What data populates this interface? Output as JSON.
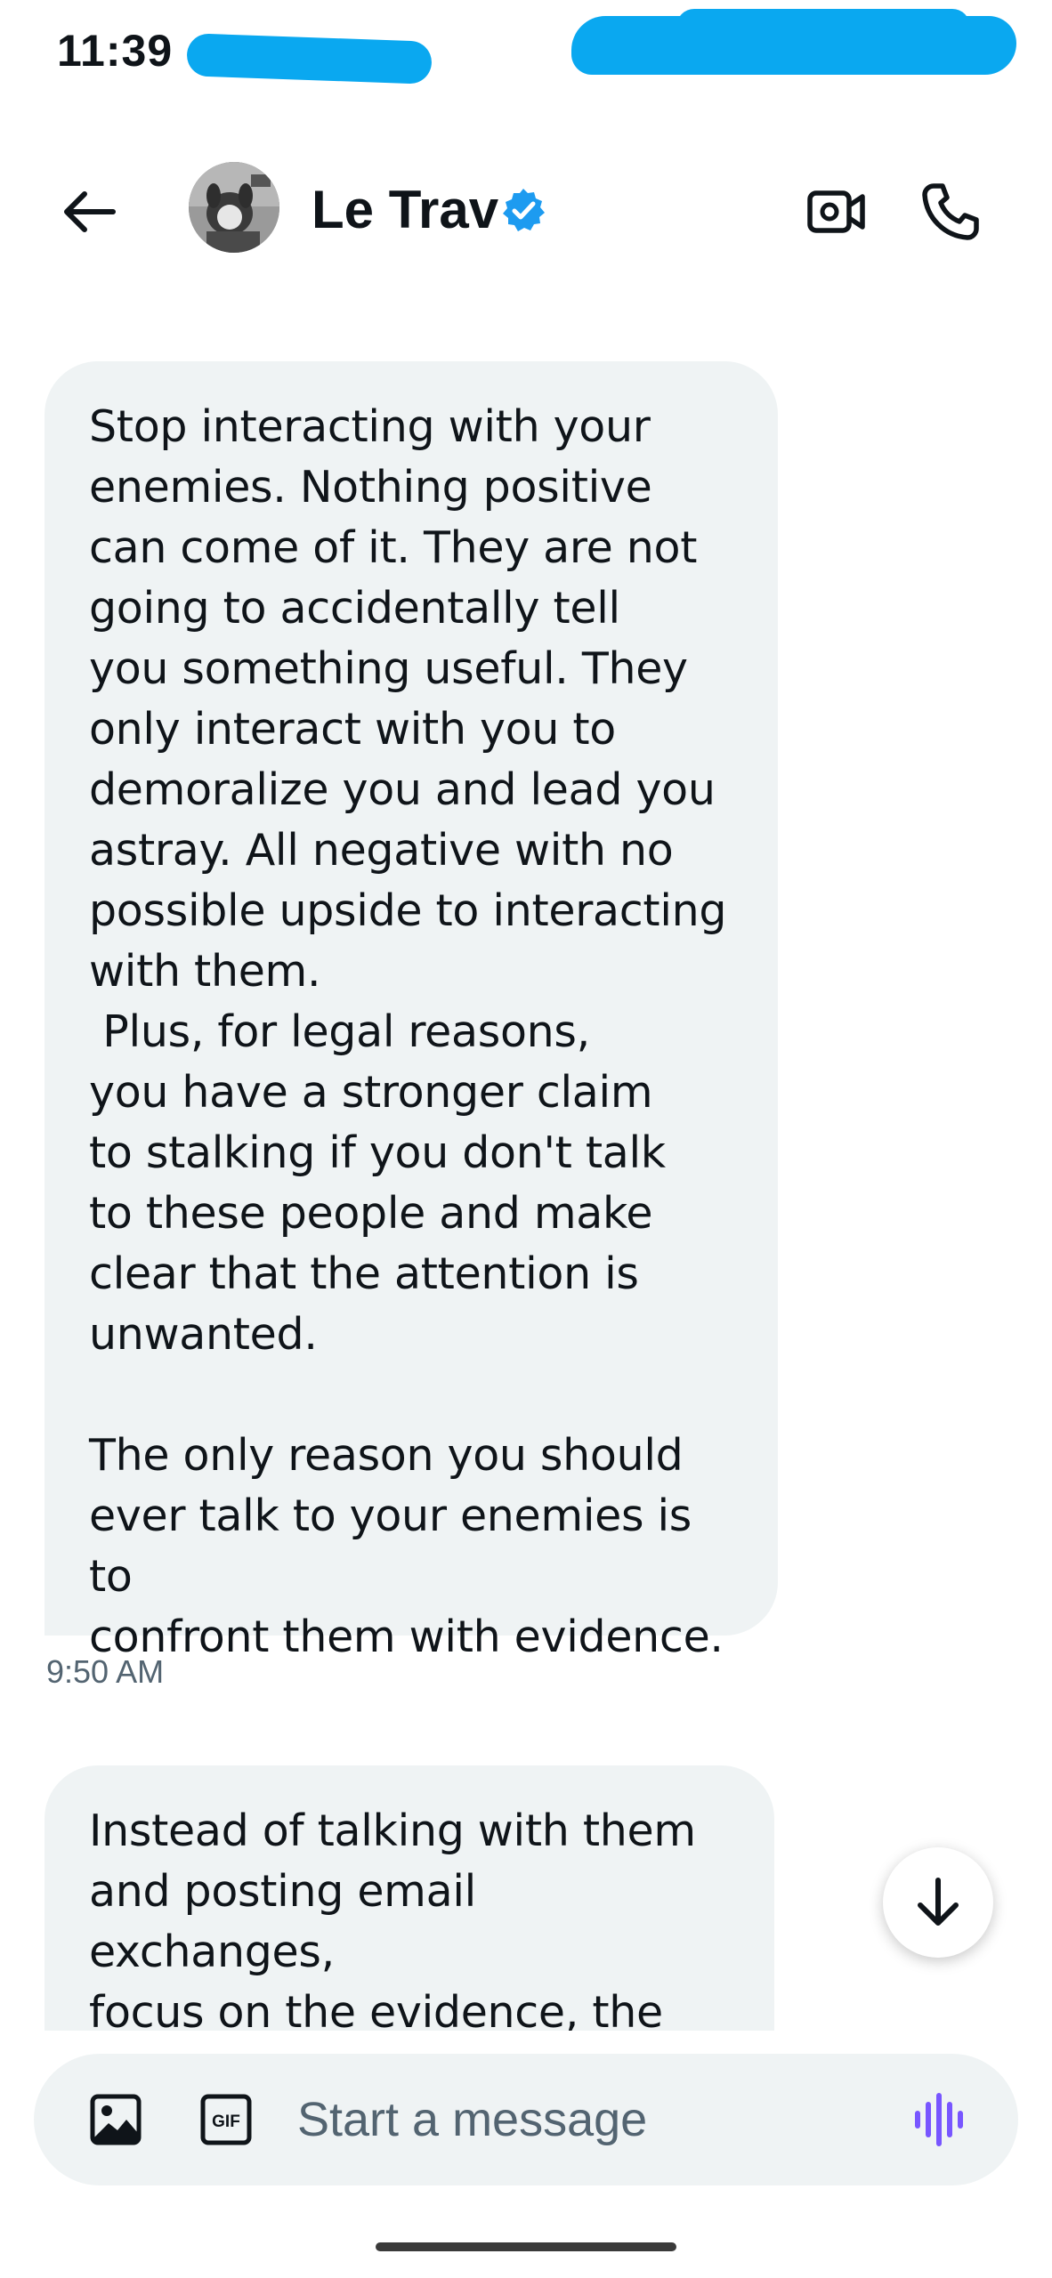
{
  "status_bar": {
    "time": "11:39"
  },
  "header": {
    "contact_name": "Le Trav",
    "verified": true,
    "icons": {
      "back": "arrow-left-icon",
      "verified": "verified-badge-icon",
      "video": "video-camera-icon",
      "call": "phone-icon"
    },
    "accent_color": "#1d9bf0"
  },
  "messages": [
    {
      "text": "Stop interacting with your\nenemies. Nothing positive\ncan come of it. They are not\ngoing to accidentally tell\nyou something useful. They\nonly interact with you to\ndemoralize you and lead you\nastray. All negative with no\npossible upside to interacting\nwith them.\n Plus, for legal reasons,\nyou have a stronger claim\nto stalking if you don't talk\nto these people and make\nclear that the attention is\nunwanted.\n\nThe only reason you should\never talk to your enemies is to\nconfront them with evidence.",
      "timestamp": "9:50 AM"
    },
    {
      "text": "Instead of talking with them\nand posting email exchanges,\nfocus on the evidence, the\npeople and connections."
    }
  ],
  "composer": {
    "placeholder": "Start a message",
    "icons": {
      "media": "image-icon",
      "gif": "gif-icon",
      "voice": "voice-waveform-icon"
    },
    "gif_label": "GIF",
    "voice_color": "#7856ff"
  },
  "scroll_down_icon": "arrow-down-icon"
}
